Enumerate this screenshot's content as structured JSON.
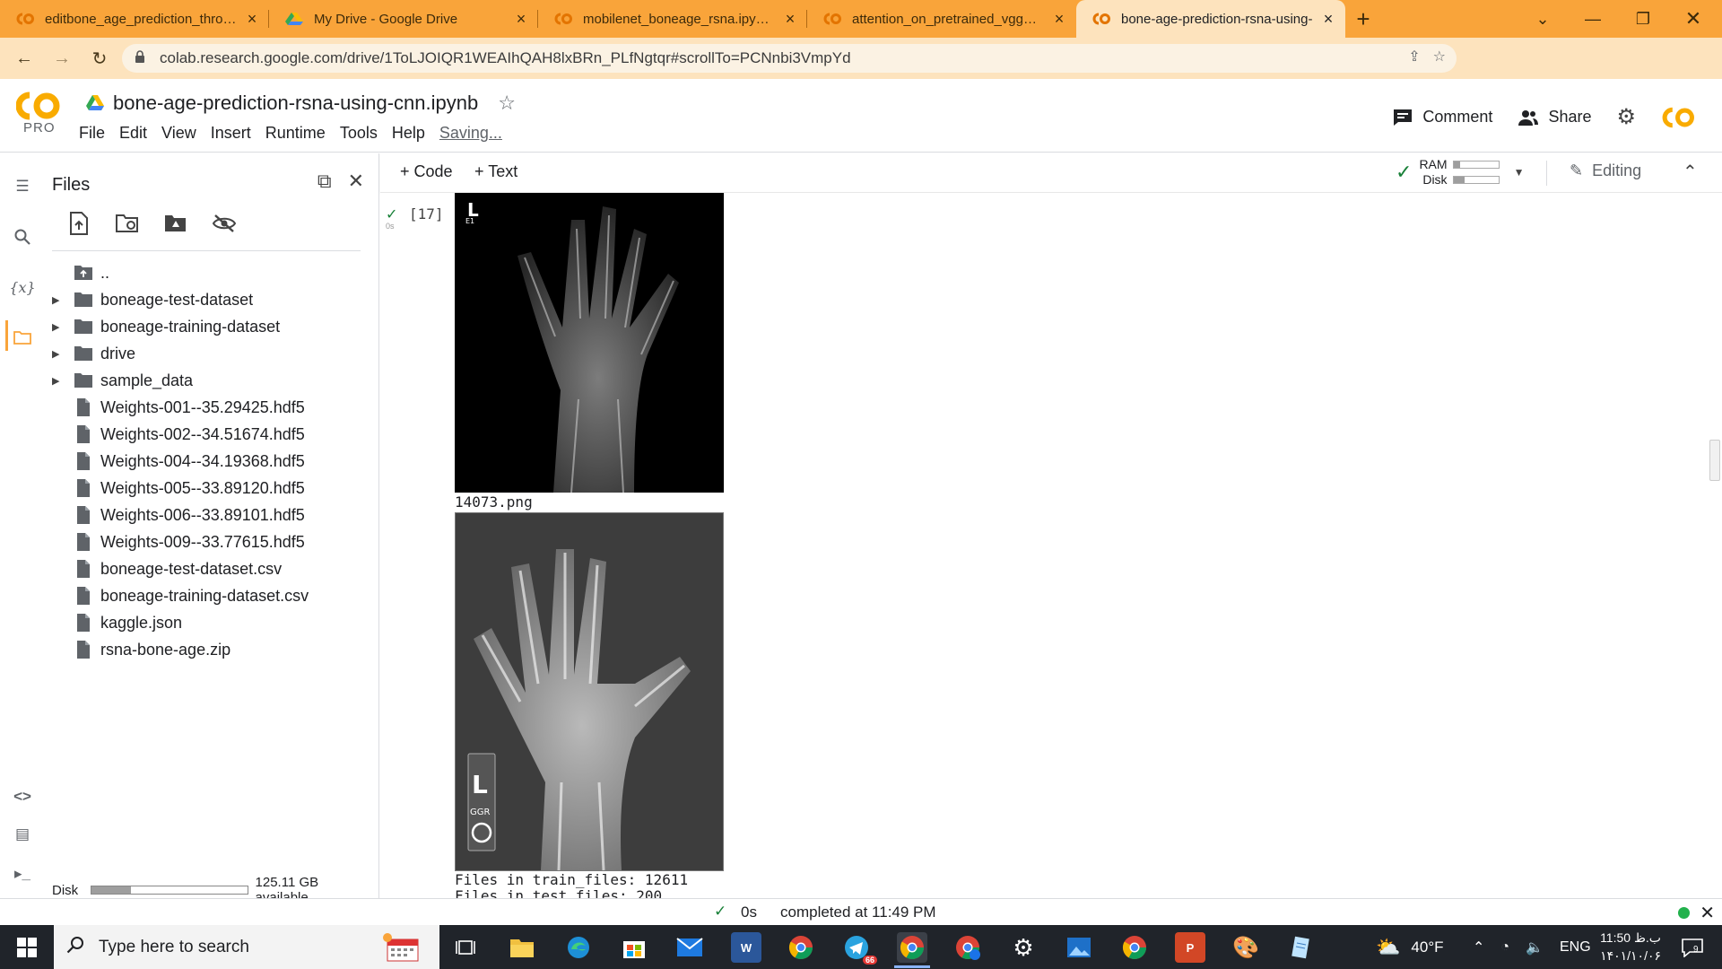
{
  "browser": {
    "tabs": [
      {
        "title": "editbone_age_prediction_through",
        "active": false,
        "favicon": "colab-icon"
      },
      {
        "title": "My Drive - Google Drive",
        "active": false,
        "favicon": "drive-icon"
      },
      {
        "title": "mobilenet_boneage_rsna.ipynb -",
        "active": false,
        "favicon": "colab-icon"
      },
      {
        "title": "attention_on_pretrained_vgg16_f",
        "active": false,
        "favicon": "colab-icon"
      },
      {
        "title": "bone-age-prediction-rsna-using-",
        "active": true,
        "favicon": "colab-icon"
      }
    ],
    "url": "colab.research.google.com/drive/1ToLJOIQR1WEAIhQAH8lxBRn_PLfNgtqr#scrollTo=PCNnbi3VmpYd",
    "tab_strip_color": "#f9a43a",
    "toolbar_color": "#fde3bd"
  },
  "colab": {
    "logo": "CO",
    "tier": "PRO",
    "notebook_name": "bone-age-prediction-rsna-using-cnn.ipynb",
    "menu": [
      "File",
      "Edit",
      "View",
      "Insert",
      "Runtime",
      "Tools",
      "Help"
    ],
    "saving_status": "Saving...",
    "comment_label": "Comment",
    "share_label": "Share",
    "accent": "#f9ab00"
  },
  "files_panel": {
    "title": "Files",
    "items": [
      {
        "name": "..",
        "kind": "up",
        "expandable": false
      },
      {
        "name": "boneage-test-dataset",
        "kind": "folder",
        "expandable": true
      },
      {
        "name": "boneage-training-dataset",
        "kind": "folder",
        "expandable": true
      },
      {
        "name": "drive",
        "kind": "folder",
        "expandable": true
      },
      {
        "name": "sample_data",
        "kind": "folder",
        "expandable": true
      },
      {
        "name": "Weights-001--35.29425.hdf5",
        "kind": "file",
        "expandable": false
      },
      {
        "name": "Weights-002--34.51674.hdf5",
        "kind": "file",
        "expandable": false
      },
      {
        "name": "Weights-004--34.19368.hdf5",
        "kind": "file",
        "expandable": false
      },
      {
        "name": "Weights-005--33.89120.hdf5",
        "kind": "file",
        "expandable": false
      },
      {
        "name": "Weights-006--33.89101.hdf5",
        "kind": "file",
        "expandable": false
      },
      {
        "name": "Weights-009--33.77615.hdf5",
        "kind": "file",
        "expandable": false
      },
      {
        "name": "boneage-test-dataset.csv",
        "kind": "file",
        "expandable": false
      },
      {
        "name": "boneage-training-dataset.csv",
        "kind": "file",
        "expandable": false
      },
      {
        "name": "kaggle.json",
        "kind": "file",
        "expandable": false
      },
      {
        "name": "rsna-bone-age.zip",
        "kind": "file",
        "expandable": false
      }
    ],
    "disk_label": "Disk",
    "disk_used_fraction": 0.25,
    "disk_available": "125.11 GB available"
  },
  "toolbar": {
    "code_label": "Code",
    "text_label": "Text",
    "ram_label": "RAM",
    "disk_label": "Disk",
    "ram_used_fraction": 0.15,
    "disk_used_fraction": 0.25,
    "editing_label": "Editing"
  },
  "cell": {
    "exec_count": "[17]",
    "exec_time": "0s",
    "image1_filename": "14073.png",
    "output_line1": "Files in train_files: 12611",
    "output_line2": "Files in test_files: 200"
  },
  "status_bar": {
    "duration": "0s",
    "message": "completed at 11:49 PM",
    "connected_color": "#22b14c"
  },
  "taskbar": {
    "search_placeholder": "Type here to search",
    "weather": "40°F",
    "language": "ENG",
    "time": "11:50 ب.ظ",
    "date": "۱۴۰۱/۱۰/۰۶",
    "notification_count": "9",
    "telegram_badge": "66"
  }
}
